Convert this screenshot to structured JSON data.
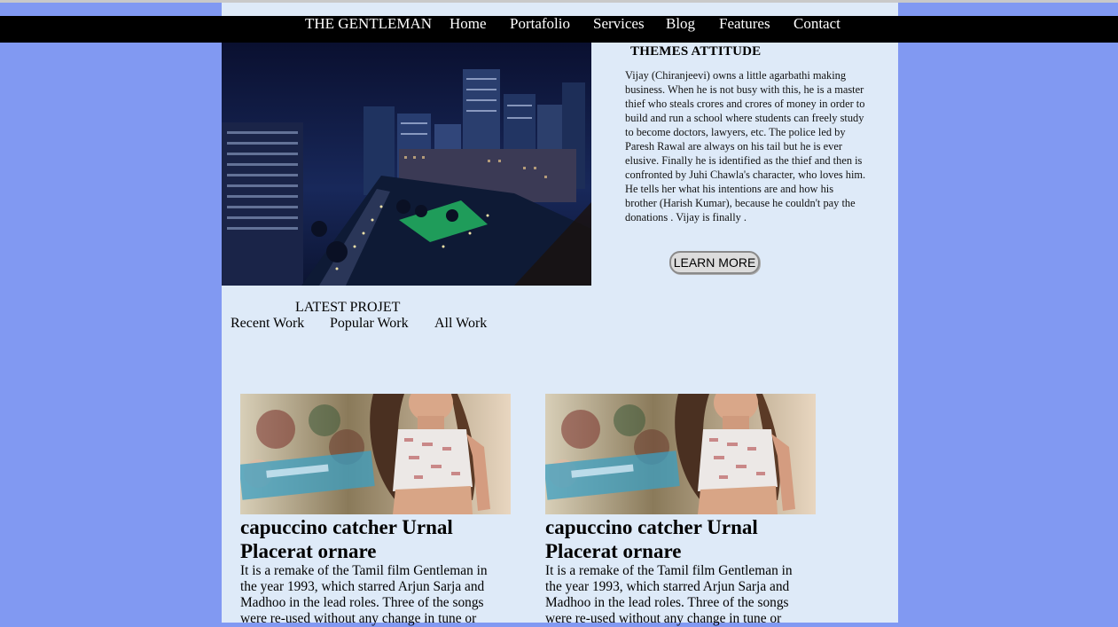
{
  "nav": {
    "brand": "THE GENTLEMAN",
    "items": [
      "Home",
      "Portafolio",
      "Services",
      "Blog",
      "Features",
      "Contact"
    ]
  },
  "hero": {
    "image_icon": "city-night-photo",
    "title": "THEMES ATTITUDE",
    "text": "Vijay (Chiranjeevi) owns a little agarbathi making business. When he is not busy with this, he is a master thief who steals crores and crores of money in order to build and run a school where students can freely study to become doctors, lawyers, etc. The police led by Paresh Rawal are always on his tail but he is ever elusive. Finally he is identified as the thief and then is confronted by Juhi Chawla's character, who loves him. He tells her what his intentions are and how his brother (Harish Kumar), because he couldn't pay the donations . Vijay is finally .",
    "button_label": "LEARN MORE"
  },
  "projects": {
    "title": "LATEST PROJET",
    "tabs": [
      "Recent Work",
      "Popular Work",
      "All Work"
    ],
    "cards": [
      {
        "image_icon": "woman-portrait-photo",
        "title": "capuccino catcher Urnal Placerat ornare",
        "text": "It is a remake of the Tamil film Gentleman in the year 1993, which starred Arjun Sarja and Madhoo in the lead roles. Three of the songs were re-used without any change in tune or"
      },
      {
        "image_icon": "woman-portrait-photo",
        "title": "capuccino catcher Urnal Placerat ornare",
        "text": "It is a remake of the Tamil film Gentleman in the year 1993, which starred Arjun Sarja and Madhoo in the lead roles. Three of the songs were re-used without any change in tune or"
      }
    ]
  },
  "colors": {
    "background": "#8199f2",
    "page": "#deeaf8",
    "navbar": "#000000"
  }
}
